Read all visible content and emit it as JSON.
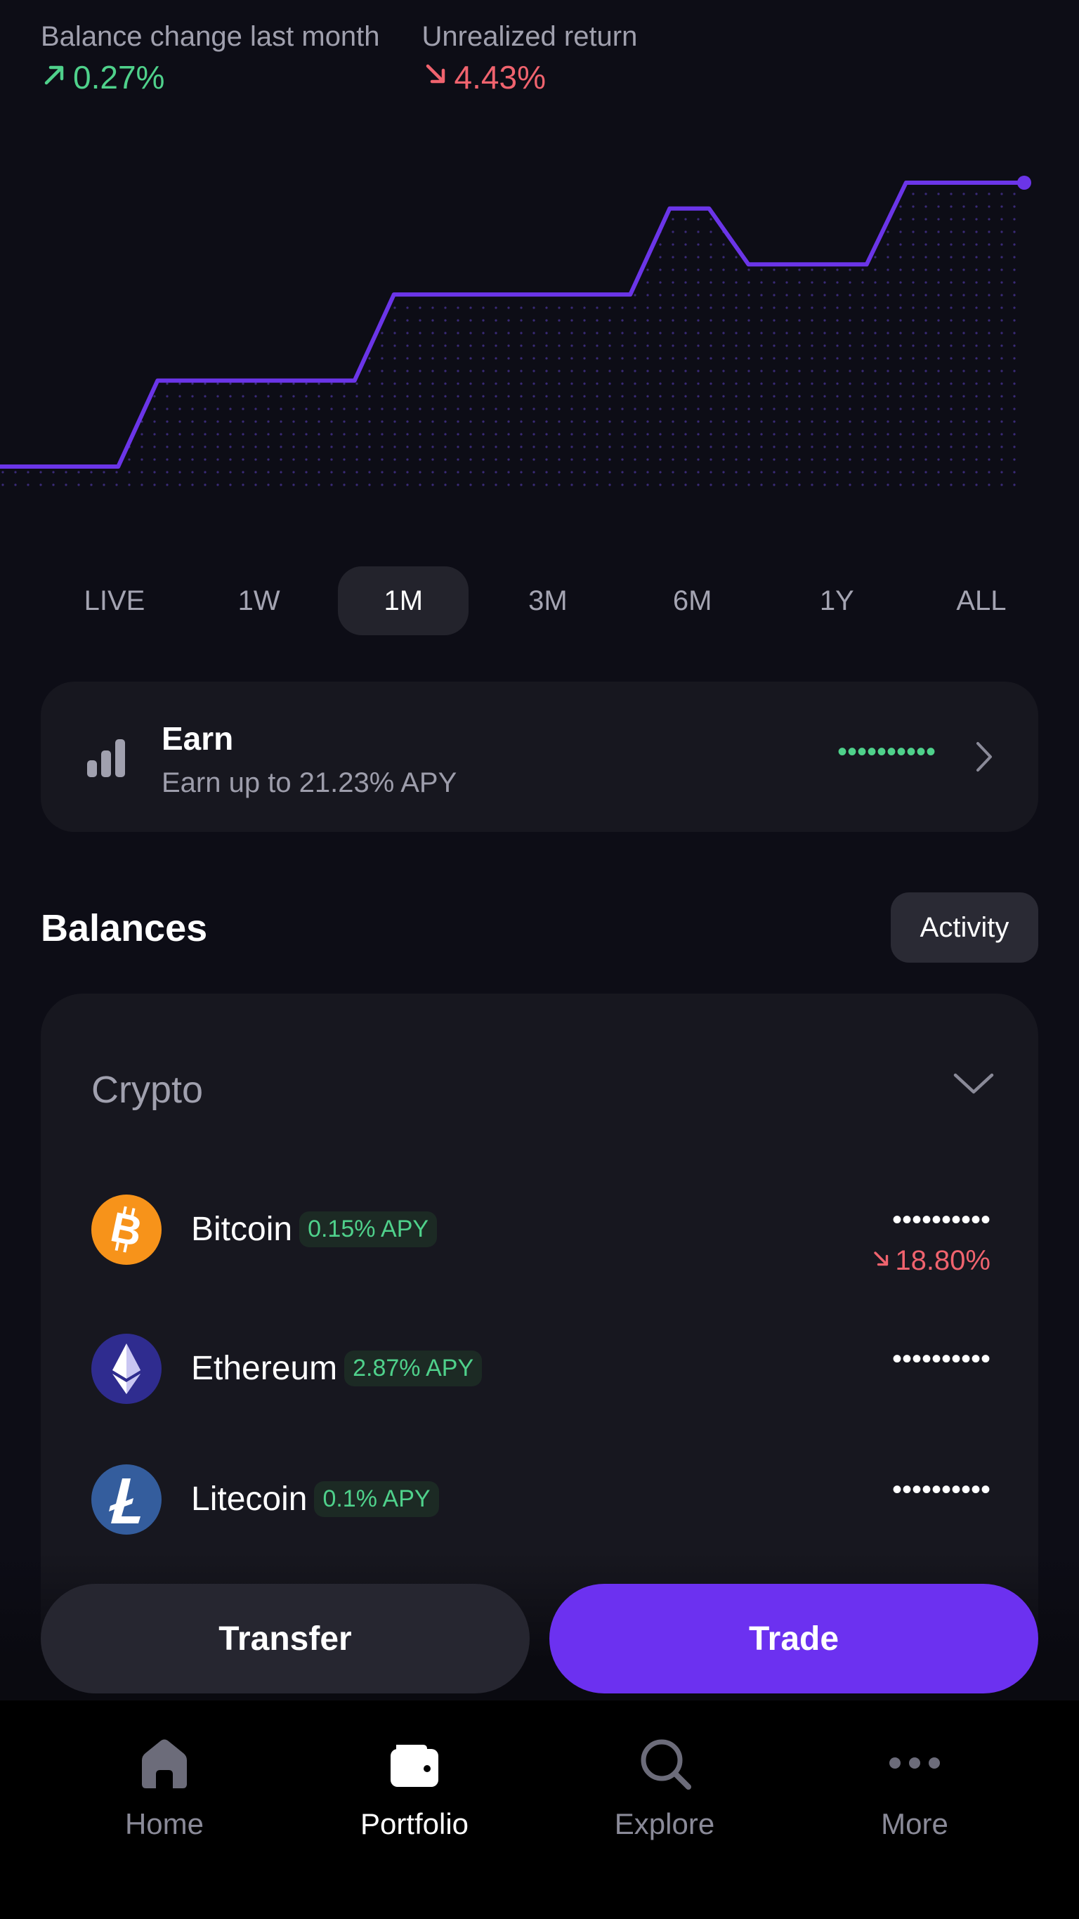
{
  "stats": {
    "balance_change_label": "Balance change last month",
    "balance_change_value": "0.27%",
    "balance_change_direction": "up",
    "unrealized_label": "Unrealized return",
    "unrealized_value": "4.43%",
    "unrealized_direction": "down"
  },
  "chart_data": {
    "type": "line",
    "series": [
      {
        "values": [
          0,
          0,
          0,
          0,
          1,
          1,
          1,
          1,
          1,
          1,
          2,
          2,
          2,
          2,
          2,
          2,
          2,
          3,
          3,
          2.35,
          2.35,
          2.35,
          2.35,
          3.3,
          3.3,
          3.3,
          3.3
        ]
      }
    ],
    "grid": false,
    "color": "#6b35e8"
  },
  "ranges": {
    "items": [
      "LIVE",
      "1W",
      "1M",
      "3M",
      "6M",
      "1Y",
      "ALL"
    ],
    "active": "1M"
  },
  "earn": {
    "title": "Earn",
    "subtitle": "Earn up to 21.23% APY",
    "hidden_value": "••••••••••"
  },
  "balances": {
    "title": "Balances",
    "activity_label": "Activity"
  },
  "crypto": {
    "title": "Crypto",
    "assets": [
      {
        "name": "Bitcoin",
        "apy": "0.15% APY",
        "value": "••••••••••",
        "change": "18.80%",
        "change_direction": "down",
        "icon": "bitcoin-icon",
        "color": "#f7931a"
      },
      {
        "name": "Ethereum",
        "apy": "2.87% APY",
        "value": "••••••••••",
        "icon": "ethereum-icon",
        "color": "#2f2c8f"
      },
      {
        "name": "Litecoin",
        "apy": "0.1% APY",
        "value": "••••••••••",
        "icon": "litecoin-icon",
        "color": "#345d9d"
      }
    ]
  },
  "actions": {
    "transfer_label": "Transfer",
    "trade_label": "Trade"
  },
  "tabbar": {
    "items": [
      {
        "label": "Home",
        "icon": "home-icon"
      },
      {
        "label": "Portfolio",
        "icon": "wallet-icon"
      },
      {
        "label": "Explore",
        "icon": "search-icon"
      },
      {
        "label": "More",
        "icon": "more-icon"
      }
    ],
    "active": "Portfolio"
  },
  "colors": {
    "up": "#4fd18b",
    "down": "#f0636e",
    "accent": "#6c31f0",
    "background": "#0d0d16",
    "card": "#17171f"
  }
}
